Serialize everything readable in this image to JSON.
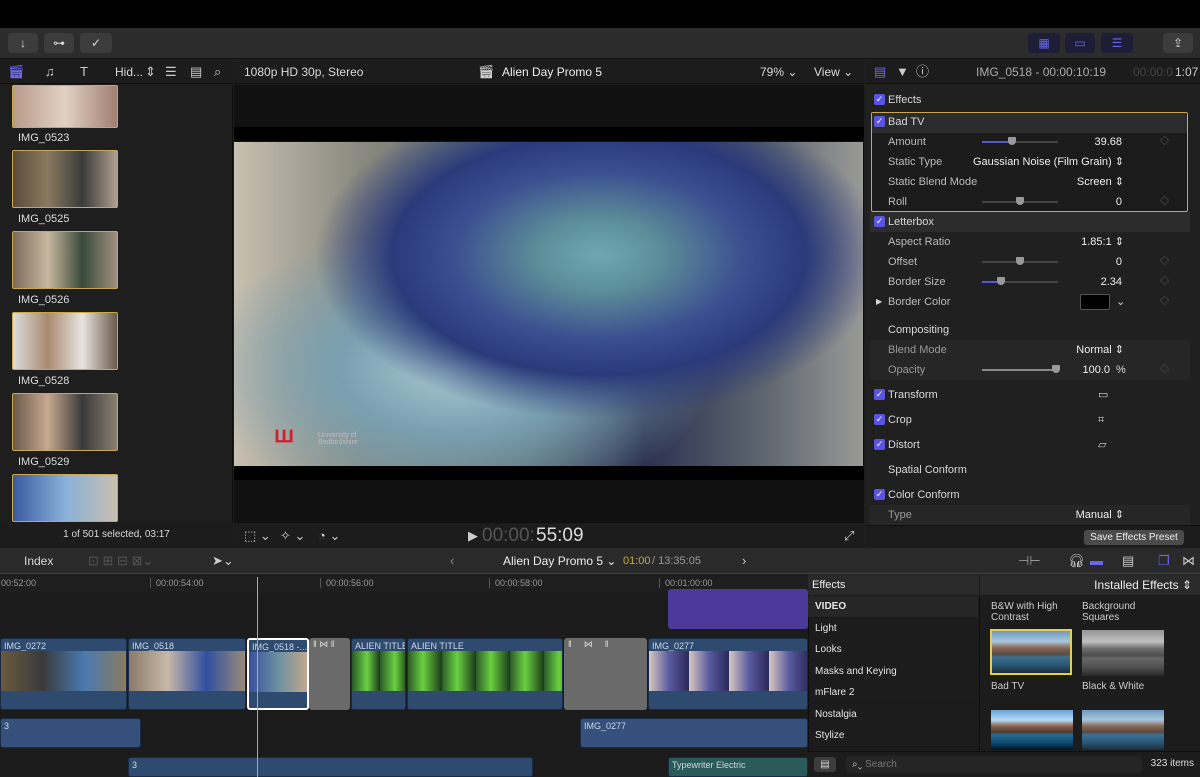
{
  "toolbar": {
    "import_icon": "arrow-down-icon",
    "keywords_icon": "key-icon",
    "check_icon": "checkmark-circle-icon",
    "share_icon": "share-icon"
  },
  "browser": {
    "filter_label": "Hid...",
    "status": "1 of 501 selected, 03:17",
    "clips": [
      {
        "name": "IMG_0523"
      },
      {
        "name": "IMG_0525"
      },
      {
        "name": "IMG_0526"
      },
      {
        "name": "IMG_0528"
      },
      {
        "name": "IMG_0529"
      },
      {
        "name": ""
      }
    ]
  },
  "viewer": {
    "format": "1080p HD 30p, Stereo",
    "project": "Alien Day Promo 5",
    "zoom": "79%",
    "view": "View",
    "timecode_dim": "00:00:",
    "timecode": "55:09",
    "watermark": "University of Bedfordshire"
  },
  "inspector": {
    "clip_title": "IMG_0518 - 00:00:10:19",
    "duration_dim": "00:00:0",
    "duration": "1:07",
    "rows": {
      "effects": "Effects",
      "badtv": "Bad TV",
      "amount": "Amount",
      "amount_val": "39.68",
      "static_type": "Static Type",
      "static_type_val": "Gaussian Noise (Film Grain)",
      "blend": "Static Blend Mode",
      "blend_val": "Screen",
      "roll": "Roll",
      "roll_val": "0",
      "letterbox": "Letterbox",
      "aspect": "Aspect Ratio",
      "aspect_val": "1.85:1",
      "offset": "Offset",
      "offset_val": "0",
      "border_size": "Border Size",
      "border_size_val": "2.34",
      "border_color": "Border Color",
      "compositing": "Compositing",
      "blend_mode": "Blend Mode",
      "blend_mode_val": "Normal",
      "opacity": "Opacity",
      "opacity_val": "100.0",
      "opacity_unit": "%",
      "transform": "Transform",
      "crop": "Crop",
      "distort": "Distort",
      "spatial": "Spatial Conform",
      "color_conform": "Color Conform",
      "type": "Type",
      "type_val": "Manual"
    },
    "amount_level": 0.4,
    "save_preset": "Save Effects Preset"
  },
  "timeline": {
    "index": "Index",
    "project": "Alien Day Promo 5",
    "position": "01:00",
    "total": "/ 13:35:05",
    "ruler": [
      "00:52:00",
      "00:00:54:00",
      "00:00:56:00",
      "00:00:58:00",
      "00:01:00:00"
    ],
    "clips": [
      "IMG_0272",
      "IMG_0518",
      "IMG_0518 -...",
      "ALIEN TITLE",
      "ALIEN TITLE",
      "IMG_0277"
    ],
    "audio": [
      "3",
      "IMG_0277",
      "3",
      "Typewriter Electric"
    ]
  },
  "effects": {
    "title": "Effects",
    "source": "Installed Effects",
    "categories": [
      "VIDEO",
      "Light",
      "Looks",
      "Masks and Keying",
      "mFlare 2",
      "Nostalgia",
      "Stylize"
    ],
    "items": [
      "B&W with High Contrast",
      "Background Squares",
      "Bad TV",
      "Black & White"
    ],
    "search_placeholder": "Search",
    "count": "323 items"
  },
  "colors": {
    "accent": "#5a55e0",
    "selection": "#c9a950"
  }
}
